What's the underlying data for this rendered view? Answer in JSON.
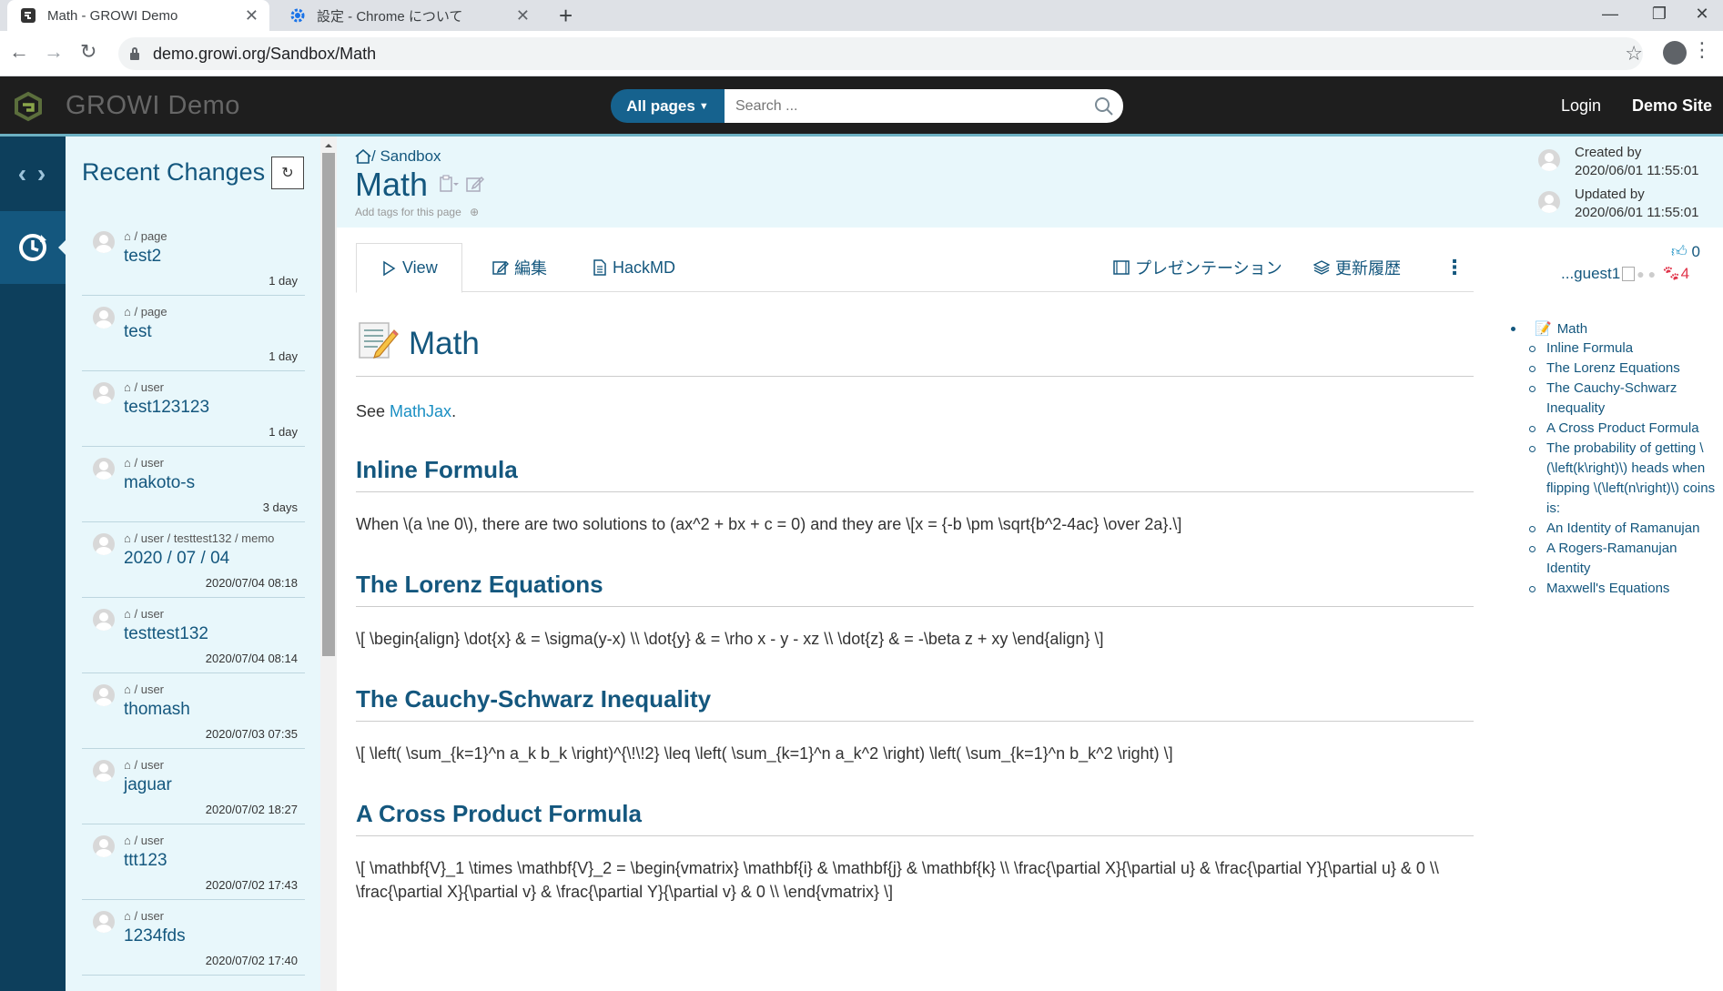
{
  "browser": {
    "tabs": [
      {
        "title": "Math - GROWI Demo"
      },
      {
        "title": "設定 - Chrome について"
      }
    ],
    "url": "demo.growi.org/Sandbox/Math"
  },
  "navbar": {
    "brand": "GROWI Demo",
    "scope_label": "All pages",
    "search_placeholder": "Search ...",
    "login": "Login",
    "demo_site": "Demo Site"
  },
  "recent": {
    "title": "Recent Changes",
    "items": [
      {
        "path": "/ page",
        "title": "test2",
        "time": "1 day"
      },
      {
        "path": "/ page",
        "title": "test",
        "time": "1 day"
      },
      {
        "path": "/ user",
        "title": "test123123",
        "time": "1 day"
      },
      {
        "path": "/ user",
        "title": "makoto-s",
        "time": "3 days"
      },
      {
        "path": "/ user / testtest132 / memo",
        "title": "2020 / 07 / 04",
        "time": "2020/07/04 08:18"
      },
      {
        "path": "/ user",
        "title": "testtest132",
        "time": "2020/07/04 08:14"
      },
      {
        "path": "/ user",
        "title": "thomash",
        "time": "2020/07/03 07:35"
      },
      {
        "path": "/ user",
        "title": "jaguar",
        "time": "2020/07/02 18:27"
      },
      {
        "path": "/ user",
        "title": "ttt123",
        "time": "2020/07/02 17:43"
      },
      {
        "path": "/ user",
        "title": "1234fds",
        "time": "2020/07/02 17:40"
      }
    ]
  },
  "page": {
    "breadcrumb": "/ Sandbox",
    "title": "Math",
    "add_tags": "Add tags for this page",
    "created_label": "Created by",
    "created_at": "2020/06/01 11:55:01",
    "updated_label": "Updated by",
    "updated_at": "2020/06/01 11:55:01"
  },
  "tabs": {
    "view": "View",
    "edit": "編集",
    "hackmd": "HackMD",
    "presentation": "プレゼンテーション",
    "history": "更新履歴"
  },
  "social": {
    "likes": "0",
    "seen_user": "...guest1",
    "seen_count": "4"
  },
  "toc": {
    "root": "Math",
    "items": [
      "Inline Formula",
      "The Lorenz Equations",
      "The Cauchy-Schwarz Inequality",
      "A Cross Product Formula",
      "The probability of getting \\(\\left(k\\right)\\) heads when flipping \\(\\left(n\\right)\\) coins is:",
      "An Identity of Ramanujan",
      "A Rogers-Ramanujan Identity",
      "Maxwell's Equations"
    ]
  },
  "content": {
    "h1": "Math",
    "see_prefix": "See ",
    "see_link": "MathJax",
    "see_suffix": ".",
    "sections": [
      {
        "heading": "Inline Formula",
        "body": "When \\(a \\ne 0\\), there are two solutions to (ax^2 + bx + c = 0) and they are \\[x = {-b \\pm \\sqrt{b^2-4ac} \\over 2a}.\\]"
      },
      {
        "heading": "The Lorenz Equations",
        "body": "\\[ \\begin{align} \\dot{x} & = \\sigma(y-x) \\\\ \\dot{y} & = \\rho x - y - xz \\\\ \\dot{z} & = -\\beta z + xy \\end{align} \\]"
      },
      {
        "heading": "The Cauchy-Schwarz Inequality",
        "body": "\\[ \\left( \\sum_{k=1}^n a_k b_k \\right)^{\\!\\!2} \\leq \\left( \\sum_{k=1}^n a_k^2 \\right) \\left( \\sum_{k=1}^n b_k^2 \\right) \\]"
      },
      {
        "heading": "A Cross Product Formula",
        "body": "\\[ \\mathbf{V}_1 \\times \\mathbf{V}_2 = \\begin{vmatrix} \\mathbf{i} & \\mathbf{j} & \\mathbf{k} \\\\ \\frac{\\partial X}{\\partial u} & \\frac{\\partial Y}{\\partial u} & 0 \\\\ \\frac{\\partial X}{\\partial v} & \\frac{\\partial Y}{\\partial v} & 0 \\\\ \\end{vmatrix} \\]"
      }
    ]
  },
  "colors": {
    "brand": "#14577e",
    "sidebar": "#0d3f5c",
    "panel": "#e8f7fb",
    "like": "#1a8fc3",
    "seen": "#e0344a"
  }
}
